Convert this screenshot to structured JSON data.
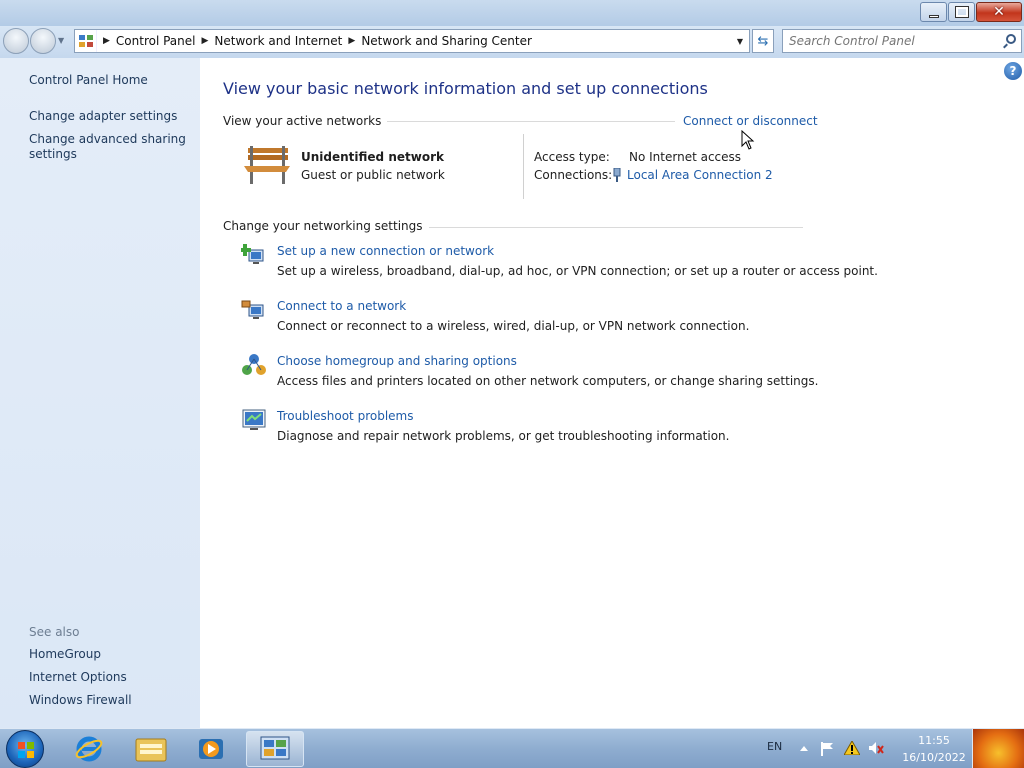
{
  "address": {
    "crumbs": [
      "Control Panel",
      "Network and Internet",
      "Network and Sharing Center"
    ]
  },
  "search": {
    "placeholder": "Search Control Panel"
  },
  "sidebar": {
    "home": "Control Panel Home",
    "links": [
      "Change adapter settings",
      "Change advanced sharing settings"
    ],
    "see_also_label": "See also",
    "see_also": [
      "HomeGroup",
      "Internet Options",
      "Windows Firewall"
    ]
  },
  "main": {
    "heading": "View your basic network information and set up connections",
    "active_networks_label": "View your active networks",
    "connect_disconnect": "Connect or disconnect",
    "network": {
      "name": "Unidentified network",
      "category": "Guest or public network",
      "access_type_label": "Access type:",
      "access_type_value": "No Internet access",
      "connections_label": "Connections:",
      "connections_value": "Local Area Connection 2"
    },
    "settings_label": "Change your networking settings",
    "tasks": [
      {
        "title": "Set up a new connection or network",
        "desc": "Set up a wireless, broadband, dial-up, ad hoc, or VPN connection; or set up a router or access point."
      },
      {
        "title": "Connect to a network",
        "desc": "Connect or reconnect to a wireless, wired, dial-up, or VPN network connection."
      },
      {
        "title": "Choose homegroup and sharing options",
        "desc": "Access files and printers located on other network computers, or change sharing settings."
      },
      {
        "title": "Troubleshoot problems",
        "desc": "Diagnose and repair network problems, or get troubleshooting information."
      }
    ]
  },
  "taskbar": {
    "language": "EN",
    "time": "11:55",
    "date": "16/10/2022"
  },
  "colors": {
    "link": "#1e5ba8",
    "heading": "#1e3287",
    "sidebar_link": "#1e395b"
  }
}
